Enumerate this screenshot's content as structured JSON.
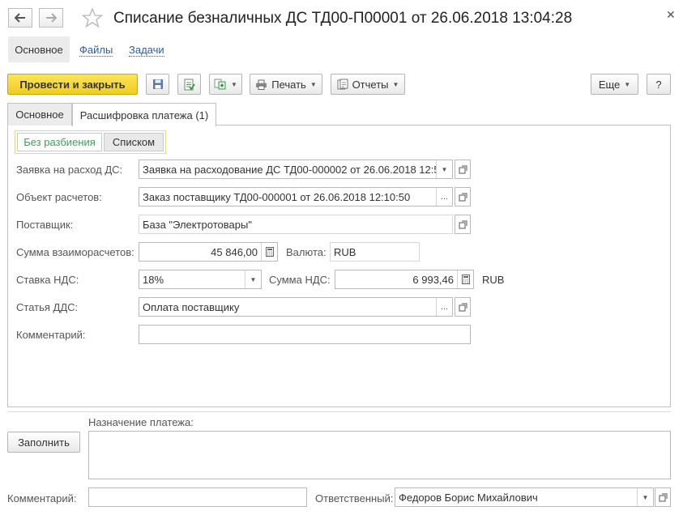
{
  "window": {
    "title": "Списание безналичных ДС ТД00-П00001 от 26.06.2018 13:04:28"
  },
  "nav": {
    "main": "Основное",
    "files": "Файлы",
    "tasks": "Задачи"
  },
  "toolbar": {
    "post_close": "Провести и закрыть",
    "print": "Печать",
    "reports": "Отчеты",
    "more": "Еще",
    "help": "?"
  },
  "tabs": {
    "main": "Основное",
    "breakdown": "Расшифровка платежа (1)"
  },
  "mode": {
    "no_split": "Без разбиения",
    "list": "Списком"
  },
  "form": {
    "request_label": "Заявка на расход ДС:",
    "request_value": "Заявка на расходование ДС ТД00-000002 от 26.06.2018 12:5",
    "object_label": "Объект расчетов:",
    "object_value": "Заказ поставщику ТД00-000001 от 26.06.2018 12:10:50",
    "supplier_label": "Поставщик:",
    "supplier_value": "База \"Электротовары\"",
    "amount_label": "Сумма взаиморасчетов:",
    "amount_value": "45 846,00",
    "currency_label": "Валюта:",
    "currency_value": "RUB",
    "vat_rate_label": "Ставка НДС:",
    "vat_rate_value": "18%",
    "vat_sum_label": "Сумма НДС:",
    "vat_sum_value": "6 993,46",
    "vat_currency": "RUB",
    "cashflow_label": "Статья ДДС:",
    "cashflow_value": "Оплата поставщику",
    "comment_label": "Комментарий:",
    "comment_value": ""
  },
  "footer": {
    "fill_button": "Заполнить",
    "purpose_label": "Назначение платежа:",
    "comment_label": "Комментарий:",
    "responsible_label": "Ответственный:",
    "responsible_value": "Федоров Борис Михайлович"
  },
  "colors": {
    "primary_button": "#f2cc1f",
    "link": "#2a5caa",
    "active_mode": "#3aa15b"
  }
}
